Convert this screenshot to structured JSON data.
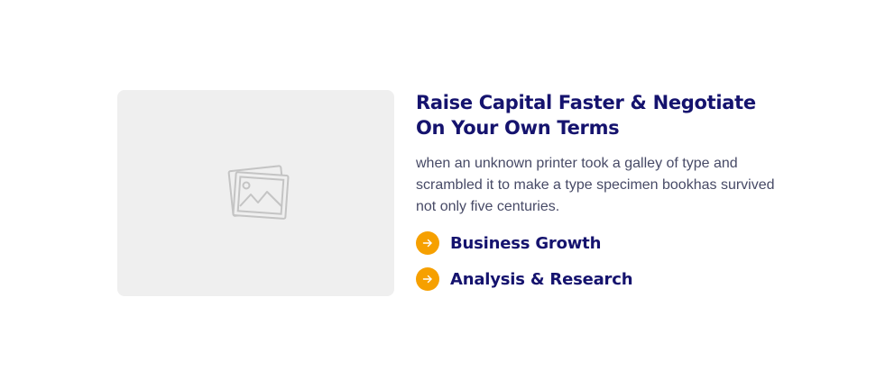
{
  "media": {
    "icon": "image-placeholder-icon"
  },
  "content": {
    "headline": "Raise Capital Faster & Negotiate On Your Own Terms",
    "description": "when an unknown printer took a galley of type and scrambled it to make a type specimen bookhas survived not only five centuries.",
    "features": [
      {
        "label": "Business Growth",
        "icon": "arrow-right-icon"
      },
      {
        "label": "Analysis & Research",
        "icon": "arrow-right-icon"
      }
    ]
  },
  "colors": {
    "heading": "#15136e",
    "body_text": "#474a66",
    "accent": "#f6a000",
    "placeholder_bg": "#efefef",
    "placeholder_icon": "#c4c4c4"
  }
}
